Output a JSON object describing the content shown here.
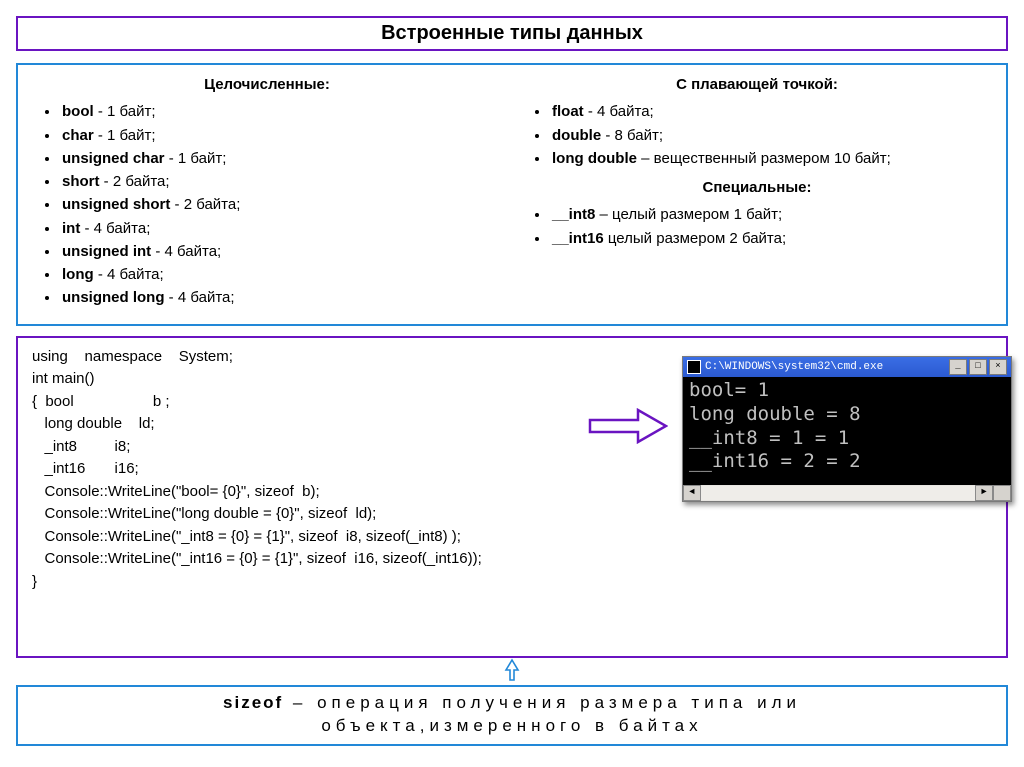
{
  "title": "Встроенные типы данных",
  "integer": {
    "header": "Целочисленные:",
    "items": [
      {
        "name": "bool",
        "size": "1 байт"
      },
      {
        "name": "char",
        "size": "1 байт"
      },
      {
        "name": "unsigned  char",
        "size": "1 байт"
      },
      {
        "name": "short",
        "size": "2 байта"
      },
      {
        "name": "unsigned  short",
        "size": "2 байта"
      },
      {
        "name": "int",
        "size": "4 байта"
      },
      {
        "name": "unsigned  int",
        "size": "4 байта"
      },
      {
        "name": "long",
        "size": "4 байта"
      },
      {
        "name": "unsigned  long",
        "size": "4 байта"
      }
    ]
  },
  "floating": {
    "header": "С плавающей точкой:",
    "items": [
      {
        "name": "float",
        "size": "4 байта"
      },
      {
        "name": "double",
        "size": "8 байт"
      },
      {
        "name": "long double",
        "size": "вещественный размером 10 байт"
      }
    ]
  },
  "special": {
    "header": "Специальные:",
    "items": [
      {
        "name": "__int8",
        "size": "целый размером 1 байт"
      },
      {
        "name": "__int16",
        "size": "целый размером 2 байта"
      }
    ]
  },
  "code": {
    "l1": "using    namespace    System;",
    "l2": "int main()",
    "l3": "{  bool                   b ;",
    "l4": "   long double    ld;",
    "l5": "   _int8         i8;",
    "l6": "   _int16       i16;",
    "l7": "   Console::WriteLine(\"bool= {0}\", sizeof  b);",
    "l8": "   Console::WriteLine(\"long double = {0}\", sizeof  ld);",
    "l9": "   Console::WriteLine(\"_int8 = {0} = {1}\", sizeof  i8, sizeof(_int8) );",
    "l10": "   Console::WriteLine(\"_int16 = {0} = {1}\", sizeof  i16, sizeof(_int16));",
    "l11": "}"
  },
  "console": {
    "title": "C:\\WINDOWS\\system32\\cmd.exe",
    "lines": [
      "bool= 1",
      "long double = 8",
      "__int8 = 1 = 1",
      "__int16 = 2 = 2"
    ]
  },
  "footer": {
    "word": "sizeof",
    "desc1": " – операция получения размера типа или",
    "desc2": "объекта,измеренного в байтах"
  }
}
